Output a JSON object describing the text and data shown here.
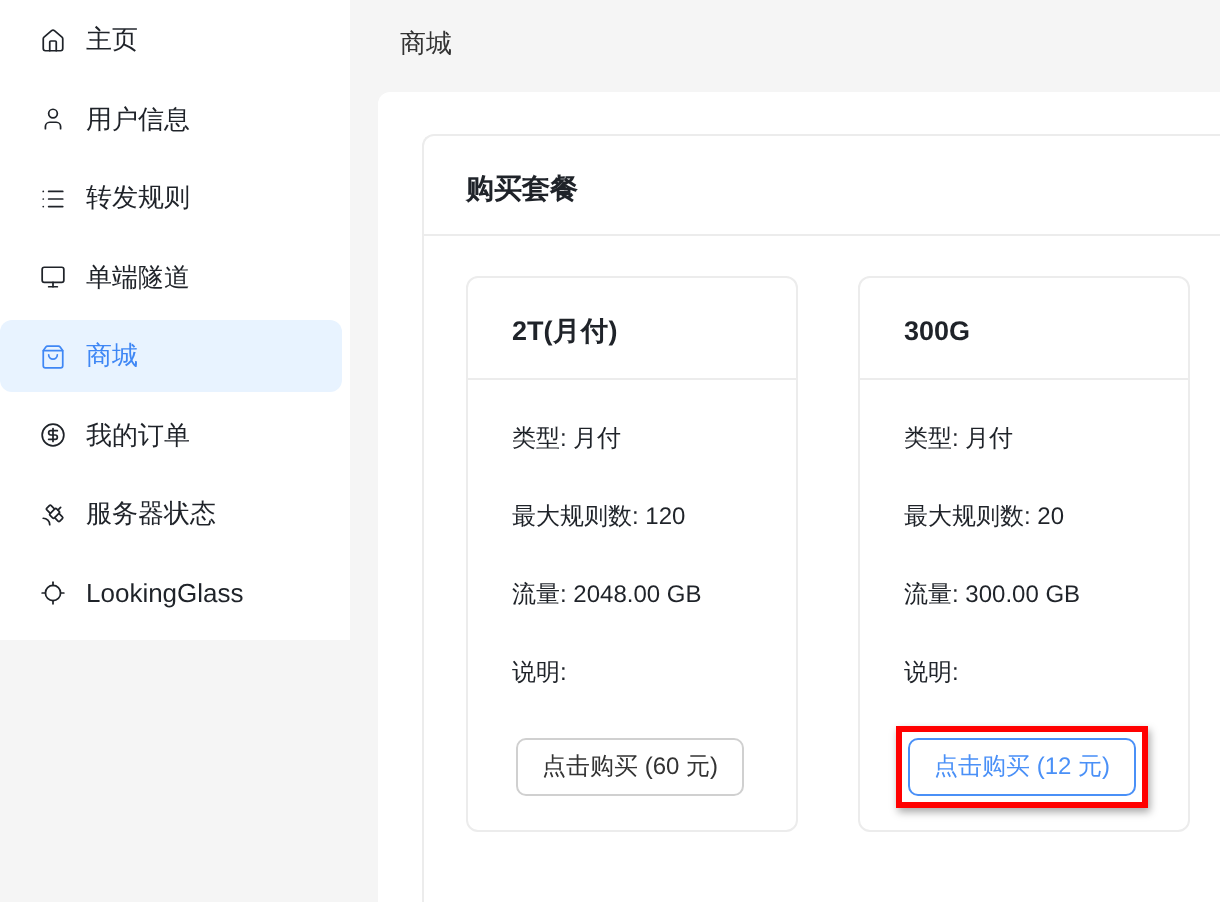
{
  "sidebar": {
    "items": [
      {
        "label": "主页",
        "selected": false
      },
      {
        "label": "用户信息",
        "selected": false
      },
      {
        "label": "转发规则",
        "selected": false
      },
      {
        "label": "单端隧道",
        "selected": false
      },
      {
        "label": "商城",
        "selected": true
      },
      {
        "label": "我的订单",
        "selected": false
      },
      {
        "label": "服务器状态",
        "selected": false
      },
      {
        "label": "LookingGlass",
        "selected": false
      }
    ]
  },
  "breadcrumb": "商城",
  "panel": {
    "title": "购买套餐",
    "plans": [
      {
        "name": "2T(月付)",
        "rows": [
          "类型: 月付",
          "最大规则数: 120",
          "流量: 2048.00 GB",
          "说明:"
        ],
        "button": "点击购买 (60 元)",
        "focused": false,
        "highlighted": false
      },
      {
        "name": "300G",
        "rows": [
          "类型: 月付",
          "最大规则数: 20",
          "流量: 300.00 GB",
          "说明:"
        ],
        "button": "点击购买 (12 元)",
        "focused": true,
        "highlighted": true
      }
    ]
  }
}
